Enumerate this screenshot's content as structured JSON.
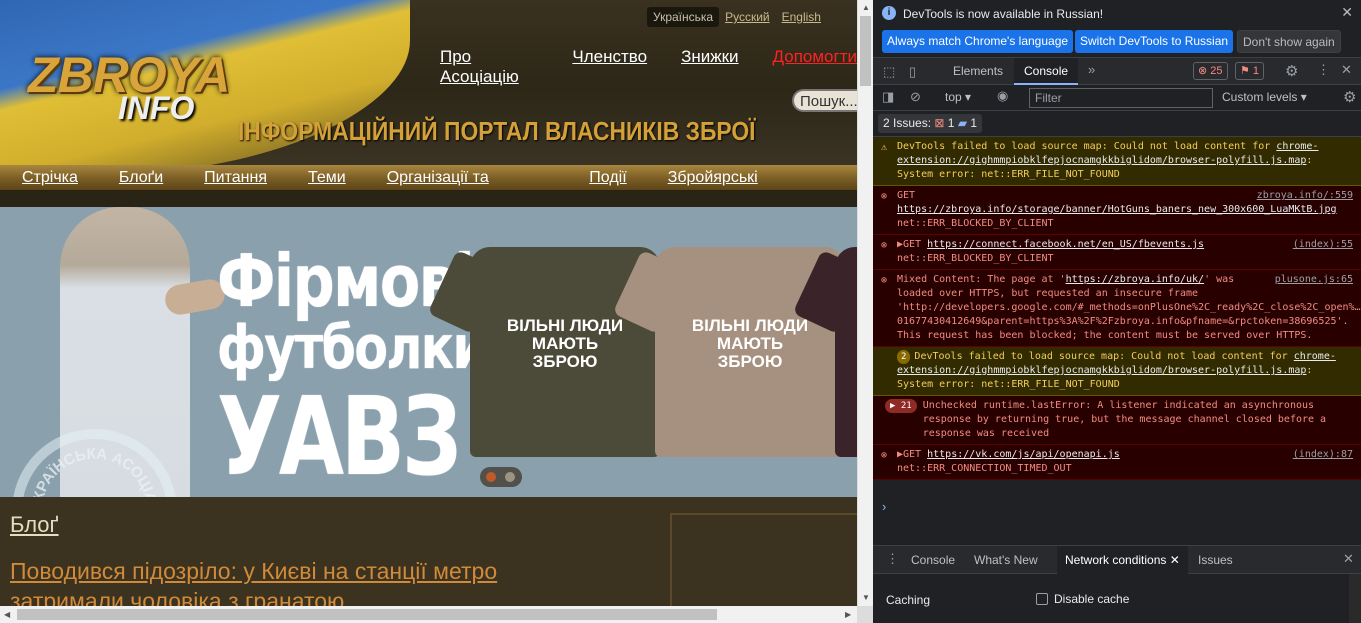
{
  "site": {
    "languages": [
      "Українська",
      "Русский",
      "English"
    ],
    "logo_top": "ZBROYA",
    "logo_bottom": "INFO",
    "tagline": "ІНФОРМАЦІЙНИЙ ПОРТАЛ ВЛАСНИКІВ ЗБРОЇ",
    "top_nav": [
      "Про Асоціацію",
      "Членство",
      "Знижки",
      "Допомогти"
    ],
    "search_placeholder": "Пошук...",
    "main_nav": [
      "Стрічка",
      "Блоґи",
      "Питання",
      "Теми",
      "Організації та партнери",
      "Події",
      "Збройярські рейтинги"
    ],
    "banner": {
      "line1": "Фірмові",
      "line2": "футболки",
      "line3": "УАВЗ",
      "shirt_text": "ВІЛЬНІ ЛЮДИ МАЮТЬ ЗБРОЮ",
      "stamp_text": "УКРАЇНСЬКА АСОЦІАЦІЯ ВЛАСНИКІВ ЗБРОЇ 20 09"
    },
    "blog_heading": "Блоґ",
    "post_title": "Поводився підозріло: у Києві на станції метро затримали чоловіка з гранатою"
  },
  "devtools": {
    "info_text": "DevTools is now available in Russian!",
    "info_buttons": [
      "Always match Chrome's language",
      "Switch DevTools to Russian",
      "Don't show again"
    ],
    "tabs": [
      "Elements",
      "Console"
    ],
    "error_count": "25",
    "issue_count": "1",
    "context": "top",
    "filter_placeholder": "Filter",
    "levels": "Custom levels",
    "issues_label": "2 Issues:",
    "issues_err": "1",
    "issues_info": "1",
    "messages": [
      {
        "type": "warn",
        "text": "DevTools failed to load source map: Could not load content for ",
        "link": "chrome-extension://gighmmpiobklfepjocnamgkkbiglidom/browser-polyfill.js.map",
        "tail": ": System error: net::ERR_FILE_NOT_FOUND",
        "src": ""
      },
      {
        "type": "err",
        "text": "GET ",
        "link": "https://zbroya.info/storage/banner/HotGuns_baners_new_300x600_LuaMKtB.jpg",
        "tail": "net::ERR_BLOCKED_BY_CLIENT",
        "src": "zbroya.info/:559"
      },
      {
        "type": "err",
        "text": "▶GET ",
        "link": "https://connect.facebook.net/en_US/fbevents.js",
        "tail": "net::ERR_BLOCKED_BY_CLIENT",
        "src": "(index):55"
      },
      {
        "type": "err",
        "text": "Mixed Content: The page at '",
        "link": "https://zbroya.info/uk/",
        "tail": "' was loaded over HTTPS, but requested an insecure frame 'http://developers.google.com/#_methods=onPlusOne%2C_ready%2C_close%2C_open%…01677430412649&parent=https%3A%2F%2Fzbroya.info&pfname=&rpctoken=38696525'. This request has been blocked; the content must be served over HTTPS.",
        "src": "plusone.js:65"
      },
      {
        "type": "warn",
        "count": "2",
        "text": "DevTools failed to load source map: Could not load content for ",
        "link": "chrome-extension://gighmmpiobklfepjocnamgkkbiglidom/browser-polyfill.js.map",
        "tail": ": System error: net::ERR_FILE_NOT_FOUND",
        "src": ""
      },
      {
        "type": "err",
        "count": "▶ 21",
        "text": "Unchecked runtime.lastError: A listener indicated an asynchronous response by returning true, but the message channel closed before a response was received",
        "link": "",
        "tail": "",
        "src": ""
      },
      {
        "type": "err",
        "text": "▶GET ",
        "link": "https://vk.com/js/api/openapi.js",
        "tail": "net::ERR_CONNECTION_TIMED_OUT",
        "src": "(index):87"
      }
    ],
    "drawer_tabs": [
      "Console",
      "What's New",
      "Network conditions",
      "Issues"
    ],
    "caching_label": "Caching",
    "disable_cache_label": "Disable cache"
  }
}
